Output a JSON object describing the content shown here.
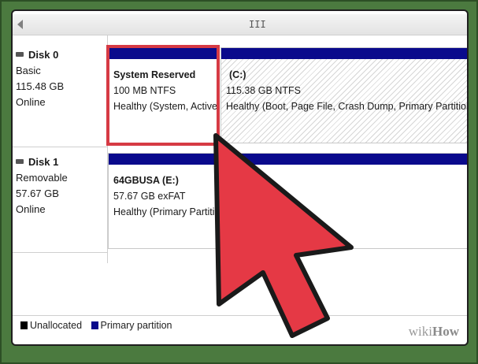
{
  "scrollbar": {
    "grip": "III"
  },
  "disks": [
    {
      "name": "Disk 0",
      "type": "Basic",
      "size": "115.48 GB",
      "status": "Online"
    },
    {
      "name": "Disk 1",
      "type": "Removable",
      "size": "57.67 GB",
      "status": "Online"
    }
  ],
  "partitions": {
    "system_reserved": {
      "name": "System Reserved",
      "size": "100 MB NTFS",
      "status": "Healthy (System, Active"
    },
    "c_drive": {
      "name": "(C:)",
      "size": "115.38 GB NTFS",
      "status": "Healthy (Boot, Page File, Crash Dump, Primary Partition)"
    },
    "usb_drive": {
      "name": "64GBUSA  (E:)",
      "size": "57.67 GB exFAT",
      "status": "Healthy (Primary Partiti"
    }
  },
  "legend": [
    {
      "label": "Unallocated",
      "color": "#000000"
    },
    {
      "label": "Primary partition",
      "color": "#0a0a8c"
    }
  ],
  "colors": {
    "partition_bar": "#0a0a8c",
    "highlight": "#d63a44",
    "cursor_fill": "#e53945",
    "frame": "#4b7a3f"
  },
  "watermark": {
    "prefix": "wiki",
    "suffix": "How"
  }
}
